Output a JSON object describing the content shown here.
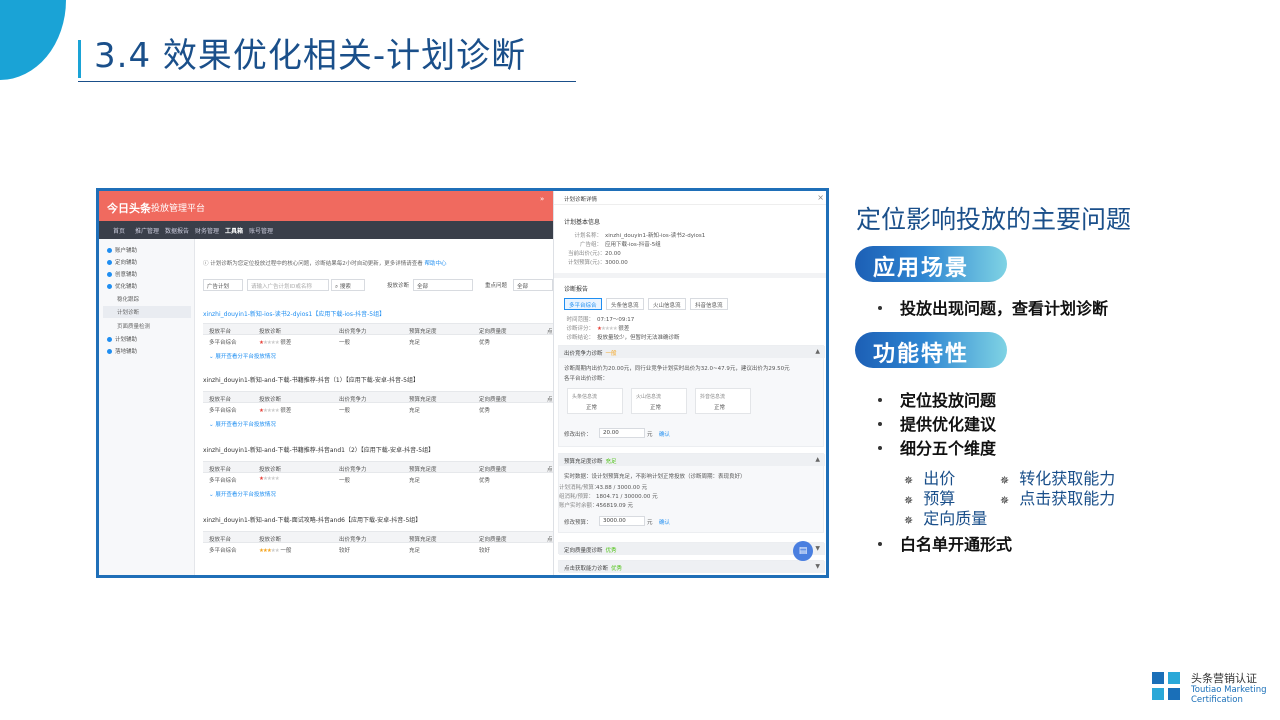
{
  "slide": {
    "title": "3.4 效果优化相关-计划诊断",
    "colors": {
      "accent": "#1aa3d6",
      "title": "#1a4f8a",
      "frame": "#1f6fb8"
    }
  },
  "app": {
    "logo": "今日头条",
    "name": "投放管理平台",
    "nav": [
      "首页",
      "推广管理",
      "数据报告",
      "财务管理",
      "工具箱",
      "账号管理"
    ],
    "nav_active": "工具箱",
    "sidebar": {
      "items": [
        {
          "label": "账户辅助"
        },
        {
          "label": "定向辅助"
        },
        {
          "label": "创意辅助"
        },
        {
          "label": "优化辅助"
        },
        {
          "label": "稳化跟踪"
        },
        {
          "label": "计划诊断"
        },
        {
          "label": "页面质量检测"
        },
        {
          "label": "计划辅助"
        },
        {
          "label": "落地辅助"
        }
      ]
    },
    "notice": {
      "text": "计划诊断为您定位投放过程中的核心问题，诊断结果每2小时自动更新，更多详情请查看",
      "link": "帮助中心"
    },
    "filter": {
      "plan_select": "广告计划",
      "search_placeholder": "请输入广告计划ID或名称",
      "search_button": "搜索",
      "diag_label": "投放诊断",
      "diag_value": "全部",
      "issue_label": "重点问题",
      "issue_value": "全部"
    },
    "table_headers": [
      "投放平台",
      "投放诊断",
      "出价竞争力",
      "预算充足度",
      "定向质量度",
      "点"
    ],
    "expand_label": "展开查看分平台投放情况",
    "blocks": [
      {
        "title": "xinzhi_douyin1-新知-ios-读书2-dyios1【应用下载-ios-抖音-5组】",
        "platform": "多平台综合",
        "rating": 1,
        "rating_text": "很差",
        "bid": "一般",
        "budget": "充足",
        "target": "优秀",
        "link": true
      },
      {
        "title": "xinzhi_douyin1-新知-and-下载-书籍推荐-抖音（1）【应用下载-安卓-抖音-5组】",
        "platform": "多平台综合",
        "rating": 1,
        "rating_text": "很差",
        "bid": "一般",
        "budget": "充足",
        "target": "优秀",
        "link": false
      },
      {
        "title": "xinzhi_douyin1-新知-and-下载-书籍推荐-抖音and1（2）【应用下载-安卓-抖音-5组】",
        "platform": "多平台综合",
        "rating": 1,
        "rating_text": "",
        "bid": "一般",
        "budget": "充足",
        "target": "优秀",
        "link": false
      },
      {
        "title": "xinzhi_douyin1-新知-and-下载-面试攻略-抖音and6【应用下载-安卓-抖音-5组】",
        "platform": "多平台综合",
        "rating": 3,
        "rating_text": "一般",
        "bid": "较好",
        "budget": "充足",
        "target": "较好",
        "link": false
      }
    ],
    "panel": {
      "title": "计划诊断详情",
      "basic_title": "计划基本信息",
      "basic": [
        {
          "k": "计划名称：",
          "v": "xinzhi_douyin1-新知-ios-读书2-dyios1"
        },
        {
          "k": "广告组：",
          "v": "应用下载-ios-抖音-5组"
        },
        {
          "k": "当前出价(元)：",
          "v": "20.00"
        },
        {
          "k": "计划预算(元)：",
          "v": "3000.00"
        }
      ],
      "report_title": "诊断报告",
      "tabs": [
        "多平台综合",
        "头条信息流",
        "火山信息流",
        "抖音信息流"
      ],
      "report": [
        {
          "k": "时间范围：",
          "v": "07:17～09:17"
        },
        {
          "k": "诊断评分：",
          "v": "很差"
        },
        {
          "k": "诊断结论：",
          "v": "投放量较少，但暂时无法准确诊断"
        }
      ],
      "bid_section": {
        "title": "出价竞争力诊断",
        "tag": "一般",
        "desc": "诊断周期内出价为20.00元，同行业竞争计划实时出价为32.0~47.9元，建议出价为29.50元",
        "sub": "各平台出价诊断：",
        "cards": [
          {
            "a": "头条信息流",
            "b": "正常"
          },
          {
            "a": "火山信息流",
            "b": "正常"
          },
          {
            "a": "抖音信息流",
            "b": "正常"
          }
        ],
        "edit_label": "修改出价：",
        "edit_value": "20.00",
        "unit": "元",
        "confirm": "确认"
      },
      "budget_section": {
        "title": "预算充足度诊断",
        "tag": "充足",
        "desc": "实时数据：设计划预算充足，不影响计划正常投放（诊断周期：表现良好）",
        "rows": [
          {
            "k": "计划消耗/预算：",
            "v": "43.88 / 3000.00 元"
          },
          {
            "k": "组消耗/预算：",
            "v": "1804.71 / 30000.00 元"
          },
          {
            "k": "账户实时余额：",
            "v": "456819.09 元"
          }
        ],
        "edit_label": "修改预算：",
        "edit_value": "3000.00",
        "unit": "元",
        "confirm": "确认"
      },
      "target_section": {
        "title": "定向质量度诊断",
        "tag": "优秀"
      },
      "click_section": {
        "title": "点击获取能力诊断",
        "tag": "优秀"
      }
    }
  },
  "right": {
    "headline": "定位影响投放的主要问题",
    "scene_pill": "应用场景",
    "scene_bullets": [
      "投放出现问题，查看计划诊断"
    ],
    "feature_pill": "功能特性",
    "feature_bullets": [
      "定位投放问题",
      "提供优化建议",
      "细分五个维度"
    ],
    "dimensions": [
      "出价",
      "转化获取能力",
      "预算",
      "点击获取能力",
      "定向质量"
    ],
    "last_bullet": "白名单开通形式"
  },
  "footer": {
    "cn": "头条营销认证",
    "en1": "Toutiao Marketing",
    "en2": "Certification"
  }
}
